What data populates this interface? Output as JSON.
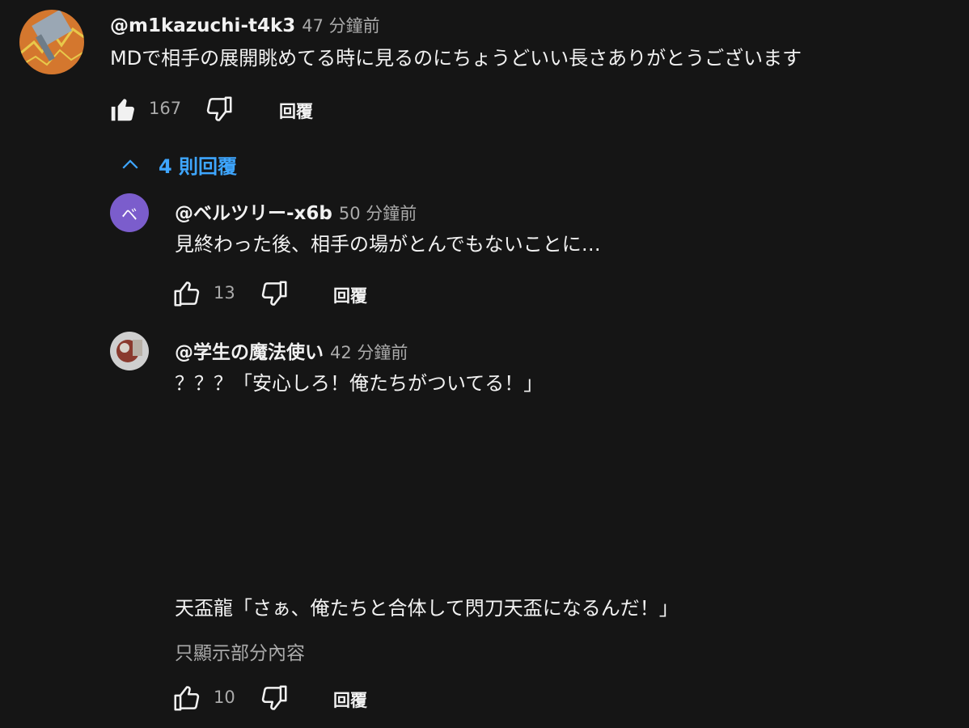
{
  "thread": {
    "author": "@m1kazuchi-t4k3",
    "time": "47 分鐘前",
    "text": "MDで相手の展開眺めてる時に見るのにちょうどいい長さありがとうございます",
    "likes": "167",
    "reply_label": "回覆",
    "replies_toggle": "4 則回覆"
  },
  "replies": [
    {
      "avatar_letter": "ベ",
      "avatar_color": "#7b5dcc",
      "author": "@ベルツリー-x6b",
      "time": "50 分鐘前",
      "text": "見終わった後、相手の場がとんでもないことに…",
      "likes": "13",
      "reply_label": "回覆"
    },
    {
      "author": "@学生の魔法使い",
      "time": "42 分鐘前",
      "text_line1": "？？？「安心しろ！俺たちがついてる！」",
      "text_line2": "天盃龍「さぁ、俺たちと合体して閃刀天盃になるんだ！」",
      "read_more": "只顯示部分內容",
      "likes": "10",
      "reply_label": "回覆"
    }
  ],
  "colors": {
    "background": "#151515",
    "link_blue": "#3ea6ff",
    "secondary_text": "#aaaaaa"
  }
}
